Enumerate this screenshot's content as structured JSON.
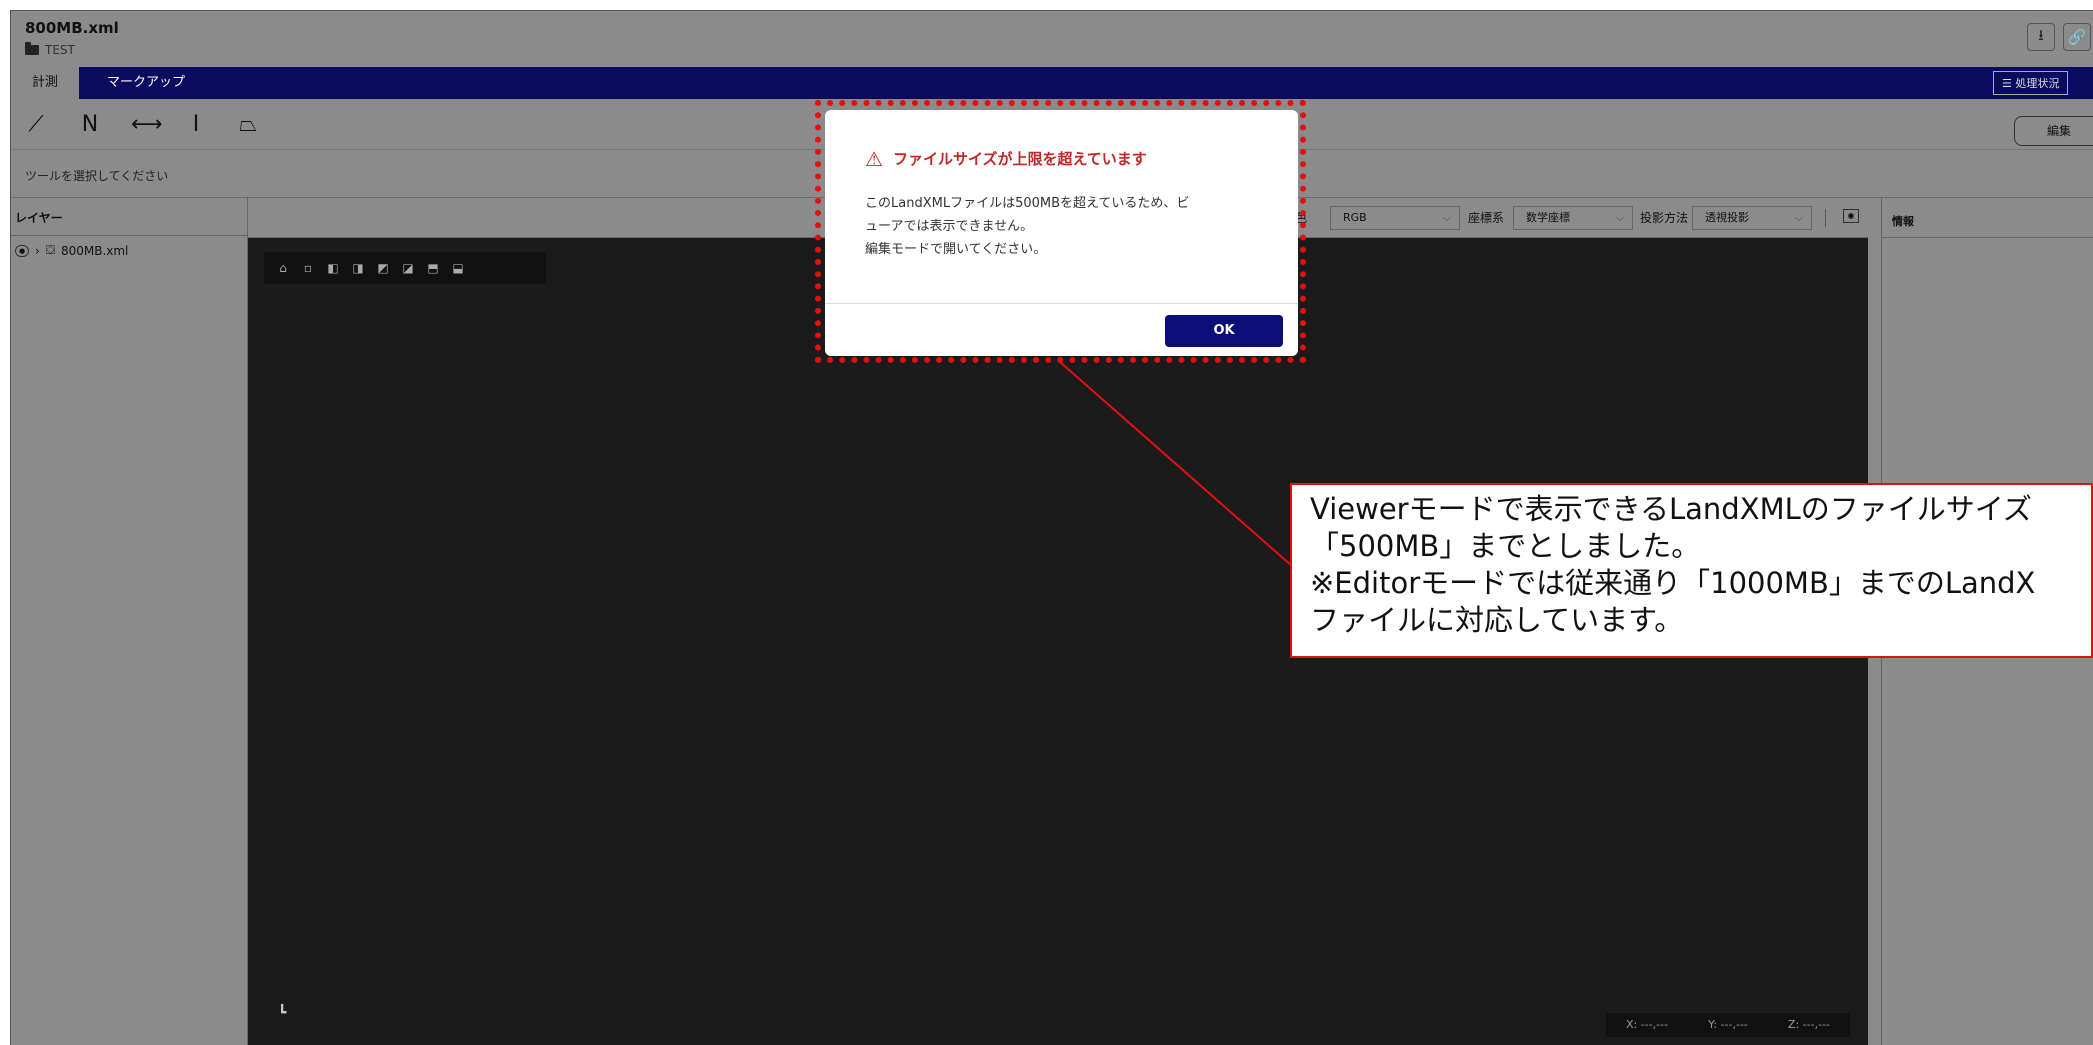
{
  "app": {
    "file_name": "800MB.xml",
    "folder": "TEST"
  },
  "header_icons": [
    "download-icon",
    "link-icon"
  ],
  "tabs": [
    {
      "label": "計測",
      "active": true
    },
    {
      "label": "マークアップ",
      "active": false
    }
  ],
  "process_button": "☰ 処理状況",
  "edit_button": "編集",
  "tools": [
    "line-measure-icon",
    "polyline-measure-icon",
    "horizontal-distance-icon",
    "vertical-distance-icon",
    "area-measure-icon"
  ],
  "tool_hint": "ツールを選択してください",
  "layers": {
    "heading": "レイヤー",
    "items": [
      {
        "name": "800MB.xml"
      }
    ]
  },
  "view_controls": {
    "color_label": "表色",
    "color_value": "RGB",
    "coord_label": "座標系",
    "coord_value": "数学座標",
    "projection_label": "投影方法",
    "projection_value": "透視投影"
  },
  "info_panel": {
    "heading": "情報"
  },
  "coords": {
    "x": "X: ---,---",
    "y": "Y: ---,---",
    "z": "Z: ---,---"
  },
  "dialog": {
    "title": "ファイルサイズが上限を超えています",
    "body": "このLandXMLファイルは500MBを超えているため、ビ\nューアでは表示できません。\n編集モードで開いてください。",
    "ok": "OK"
  },
  "callout": {
    "text": "Viewerモードで表示できるLandXMLのファイルサイズ\n「500MB」までとしました。\n※Editorモードでは従来通り「1000MB」までのLandX\nファイルに対応しています。"
  },
  "colors": {
    "background": "#8b8b8b",
    "tabbar": "#0a0a5e",
    "viewport": "#1b1b1b",
    "highlight": "#e21010",
    "warning_text": "#c0282a",
    "ok_button": "#0c0c7a"
  }
}
